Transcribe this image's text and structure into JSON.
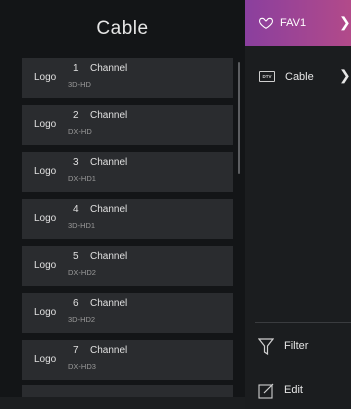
{
  "header": {
    "title": "Cable"
  },
  "channels": [
    {
      "logo": "Logo",
      "number": "1",
      "name": "Channel",
      "format": "3D-HD"
    },
    {
      "logo": "Logo",
      "number": "2",
      "name": "Channel",
      "format": "DX-HD"
    },
    {
      "logo": "Logo",
      "number": "3",
      "name": "Channel",
      "format": "DX-HD1"
    },
    {
      "logo": "Logo",
      "number": "4",
      "name": "Channel",
      "format": "3D-HD1"
    },
    {
      "logo": "Logo",
      "number": "5",
      "name": "Channel",
      "format": "DX-HD2"
    },
    {
      "logo": "Logo",
      "number": "6",
      "name": "Channel",
      "format": "3D-HD2"
    },
    {
      "logo": "Logo",
      "number": "7",
      "name": "Channel",
      "format": "DX-HD3"
    }
  ],
  "side": {
    "fav_label": "FAV1",
    "cable_label": "Cable",
    "dtv_badge": "DTV",
    "filter_label": "Filter",
    "edit_label": "Edit"
  },
  "icons": {
    "fav": "heart-icon",
    "cable": "dtv-icon",
    "filter": "funnel-icon",
    "edit": "pencil-icon",
    "chevron": "chevron-right-icon"
  },
  "colors": {
    "fav_start": "#8a3f9e",
    "fav_end": "#b24a8a",
    "row_bg": "#2a2c2f"
  }
}
